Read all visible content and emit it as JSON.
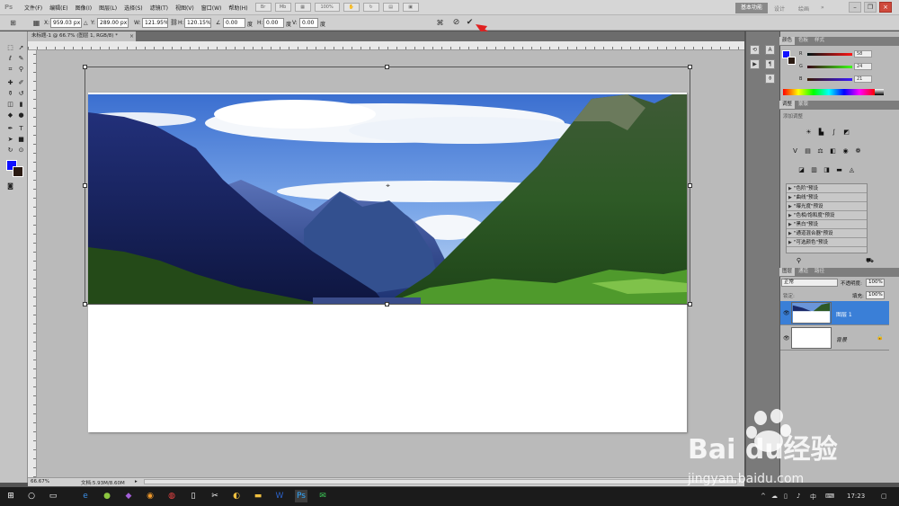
{
  "app": {
    "logo_text": "Ps",
    "menu": [
      "文件(F)",
      "编辑(E)",
      "图像(I)",
      "图层(L)",
      "选择(S)",
      "滤镜(T)",
      "视图(V)",
      "窗口(W)",
      "帮助(H)"
    ],
    "zoom_dropdown": "100%",
    "workspace_active": "基本功能",
    "workspace_links": [
      "设计",
      "绘画"
    ]
  },
  "options_bar": {
    "x_label": "X:",
    "x_value": "959.03 px",
    "y_label": "Y:",
    "y_value": "289.00 px",
    "w_label": "W:",
    "w_value": "121.95%",
    "h_label": "H:",
    "h_value": "120.15%",
    "angle_value": "0.00",
    "angle_unit": "度",
    "hskew_label": "H:",
    "hskew_value": "0.00",
    "hskew_unit": "度",
    "vskew_label": "V:",
    "vskew_value": "0.00",
    "vskew_unit": "度",
    "cancel_icon": "cancel-transform-icon",
    "commit_icon": "commit-checkmark-icon"
  },
  "document": {
    "tab_title": "未标题-1 @ 66.7% (图层 1, RGB/8) *",
    "zoom": "66.67%",
    "doc_size": "文档:5.93M/8.60M"
  },
  "color_panel": {
    "tabs": [
      "颜色",
      "色板",
      "样式"
    ],
    "r_value": "58",
    "g_value": "24",
    "b_value": "21",
    "foreground": "#1010ff",
    "background": "#2a1a12"
  },
  "adjustments_panel": {
    "tabs": [
      "调整",
      "蒙版"
    ],
    "subtitle": "添加调整",
    "presets": [
      "\"色阶\"预设",
      "\"曲线\"预设",
      "\"曝光度\"预设",
      "\"色相/饱和度\"预设",
      "\"黑白\"预设",
      "\"通道混合器\"预设",
      "\"可选颜色\"预设"
    ]
  },
  "layers_panel": {
    "tabs": [
      "图层",
      "通道",
      "路径"
    ],
    "blend_mode": "正常",
    "opacity_label": "不透明度:",
    "opacity_value": "100%",
    "lock_label": "锁定:",
    "fill_label": "填充:",
    "fill_value": "100%",
    "layers": [
      {
        "name": "图层 1",
        "selected": true
      },
      {
        "name": "背景",
        "selected": false
      }
    ]
  },
  "taskbar": {
    "time": "17:23",
    "ime": "中"
  },
  "watermark": {
    "brand": "Bai du经验",
    "url": "jingyan.baidu.com"
  }
}
